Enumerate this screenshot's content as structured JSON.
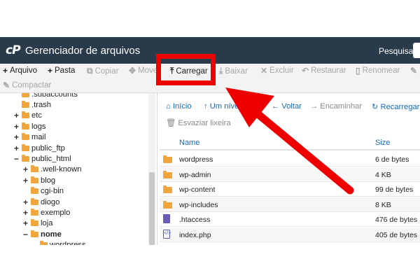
{
  "header": {
    "logo_text": "cP",
    "title": "Gerenciador de arquivos",
    "search_label": "Pesquisar"
  },
  "toolbar": {
    "arquivo": "Arquivo",
    "pasta": "Pasta",
    "copiar": "Copiar",
    "mover": "Mover",
    "carregar": "Carregar",
    "baixar": "Baixar",
    "excluir": "Excluir",
    "restaurar": "Restaurar",
    "renomear": "Renomear",
    "compactar": "Compactar"
  },
  "tree": {
    "items": [
      {
        "label": ".subaccounts",
        "prefix": ""
      },
      {
        "label": ".trash",
        "prefix": ""
      },
      {
        "label": "etc",
        "prefix": "+"
      },
      {
        "label": "logs",
        "prefix": "+"
      },
      {
        "label": "mail",
        "prefix": "+"
      },
      {
        "label": "public_ftp",
        "prefix": "+"
      },
      {
        "label": "public_html",
        "prefix": "−"
      },
      {
        "label": ".well-known",
        "prefix": "+"
      },
      {
        "label": "blog",
        "prefix": "+"
      },
      {
        "label": "cgi-bin",
        "prefix": ""
      },
      {
        "label": "diogo",
        "prefix": "+"
      },
      {
        "label": "exemplo",
        "prefix": "+"
      },
      {
        "label": "loja",
        "prefix": "+"
      },
      {
        "label": "nome",
        "prefix": "−"
      },
      {
        "label": "wordpress",
        "prefix": ""
      }
    ]
  },
  "navbar": {
    "inicio": "Início",
    "up_level": "Um nível acima",
    "voltar": "Voltar",
    "encaminhar": "Encaminhar",
    "recarregar": "Recarregar",
    "esvaziar": "Esvaziar lixeira"
  },
  "table": {
    "col_name": "Name",
    "col_size": "Size",
    "rows": [
      {
        "name": "wordpress",
        "size": "6 de bytes",
        "kind": "folder"
      },
      {
        "name": "wp-admin",
        "size": "4 KB",
        "kind": "folder"
      },
      {
        "name": "wp-content",
        "size": "99 de bytes",
        "kind": "folder"
      },
      {
        "name": "wp-includes",
        "size": "8 KB",
        "kind": "folder"
      },
      {
        "name": ".htaccess",
        "size": "476 de bytes",
        "kind": "doc"
      },
      {
        "name": "index.php",
        "size": "405 de bytes",
        "kind": "php"
      }
    ]
  },
  "colors": {
    "header_bg": "#293a4a",
    "link_blue": "#1b68b3",
    "folder": "#f0a63c",
    "annotation_red": "#ee0000"
  }
}
